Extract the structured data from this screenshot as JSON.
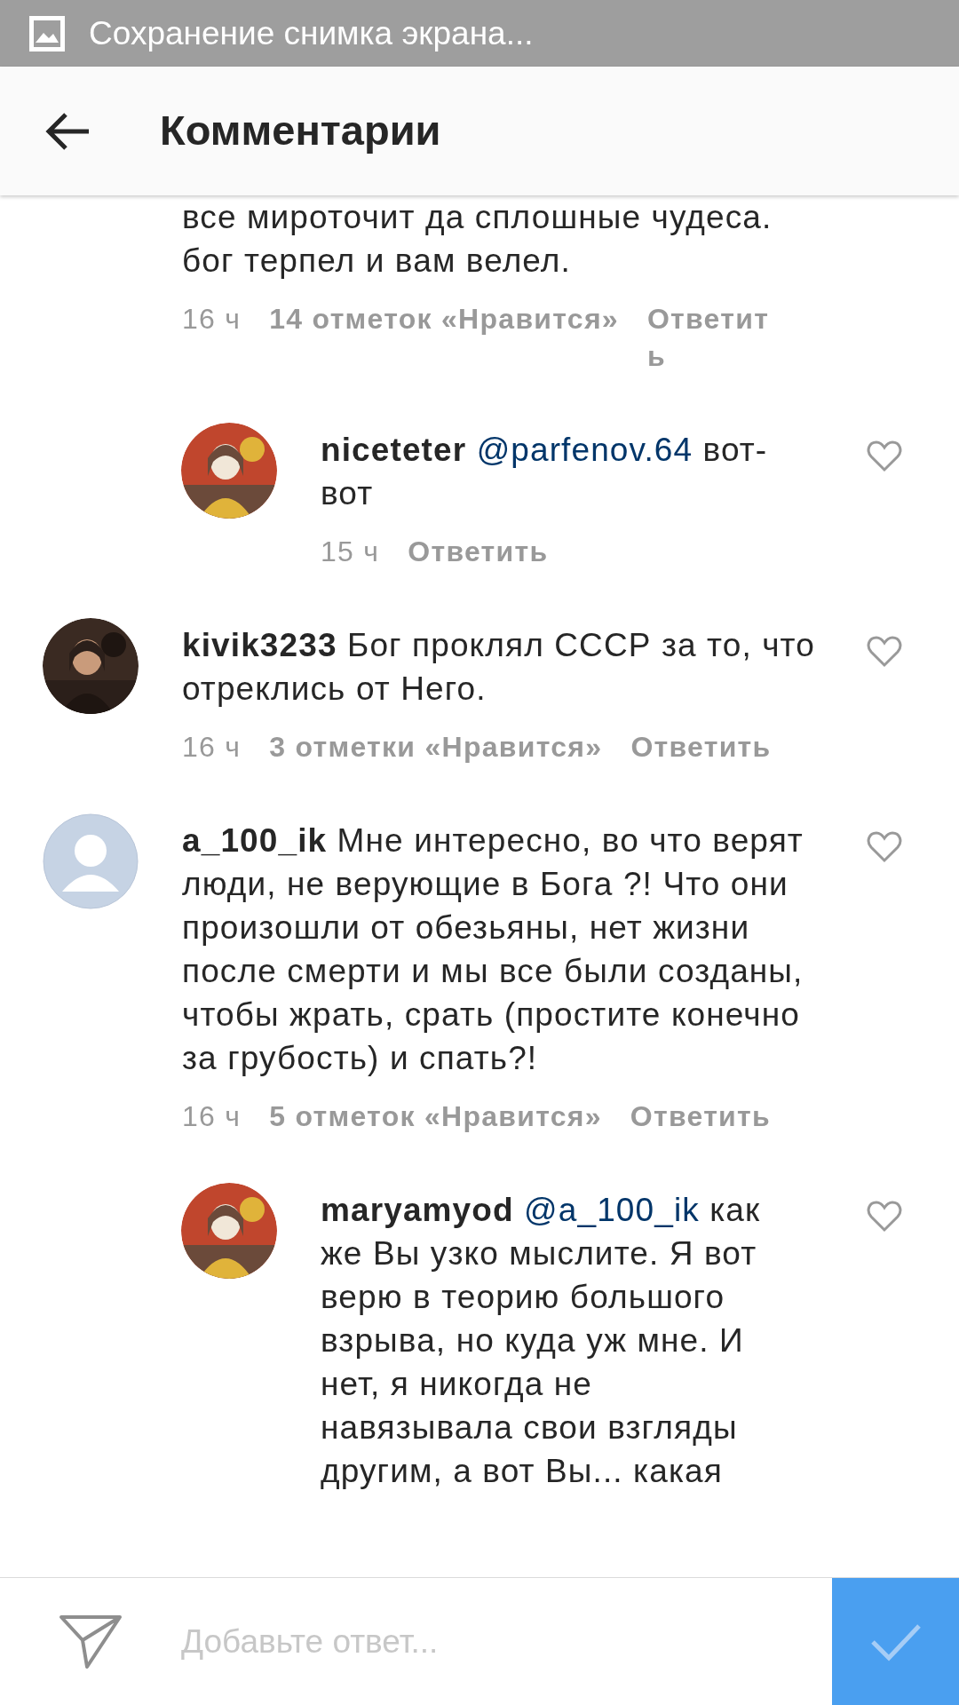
{
  "status_bar": {
    "text": "Сохранение снимка экрана..."
  },
  "header": {
    "title": "Комментарии"
  },
  "comments": [
    {
      "text": "все мироточит да сплошные чудеса. бог терпел и вам велел.",
      "time": "16 ч",
      "likes": "14 отметок «Нравится»",
      "reply": "Ответить",
      "like_button": false,
      "children": [
        {
          "username": "niceteter",
          "mention": "@parfenov.64",
          "text": "вот-вот",
          "time": "15 ч",
          "reply": "Ответить",
          "like_button": true
        }
      ]
    },
    {
      "username": "kivik3233",
      "text": "Бог проклял СССР за то, что отреклись от Него.",
      "time": "16 ч",
      "likes": "3 отметки «Нравится»",
      "reply": "Ответить",
      "like_button": true
    },
    {
      "avatar": {
        "kind": "placeholder"
      },
      "username": "a_100_ik",
      "text": "Мне интересно, во что верят люди, не верующие в Бога ?! Что они произошли от обезьяны, нет жизни после смерти и мы все были созданы, чтобы жрать, срать (простите конечно за грубость) и спать?!",
      "time": "16 ч",
      "likes": "5 отметок «Нравится»",
      "reply": "Ответить",
      "like_button": true,
      "children": [
        {
          "username": "maryamyod",
          "mention": "@a_100_ik",
          "text": "как же Вы узко мыслите. Я вот верю в теорию большого взрыва, но куда уж мне. И нет, я никогда не навязывала свои взгляды другим, а вот Вы... какая",
          "like_button": true
        }
      ]
    }
  ],
  "composer": {
    "placeholder": "Добавьте ответ...",
    "post_disabled": true
  }
}
